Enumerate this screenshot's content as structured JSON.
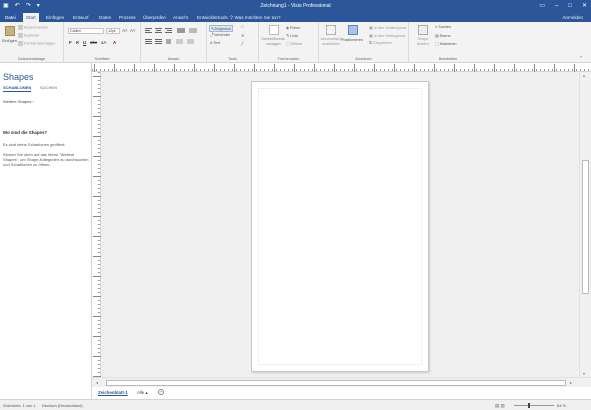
{
  "titlebar": {
    "title": "Zeichnung1 - Visio Professional",
    "qat": [
      "save-icon",
      "undo-icon",
      "redo-icon",
      "customize-icon"
    ],
    "window_buttons": [
      "▭",
      "–",
      "□",
      "✕"
    ]
  },
  "tabs": {
    "items": [
      "Datei",
      "Start",
      "Einfügen",
      "Entwurf",
      "Daten",
      "Prozess",
      "Überprüfen",
      "Ansicht",
      "Entwicklertools"
    ],
    "tellme": "Was möchten Sie tun?",
    "share": "Anmelden"
  },
  "ribbon": {
    "clipboard": {
      "paste": "Einfügen",
      "cut": "Ausschneiden",
      "copy": "Kopieren",
      "format_painter": "Format übertragen",
      "label": "Zwischenablage"
    },
    "font": {
      "font_name": "Calibri",
      "font_size": "12pt.",
      "bold": "F",
      "italic": "K",
      "underline": "U",
      "strike": "abc",
      "case": "aA",
      "color": "A",
      "label": "Schriftart"
    },
    "paragraph": {
      "label": "Absatz"
    },
    "tools": {
      "pointer": "Zeigertool",
      "connector": "Verbinder",
      "text": "Text",
      "label": "Tools"
    },
    "shape_styles": {
      "quick_styles": "Schnellformat-vorlagen",
      "fill": "Füllen",
      "line": "Linie",
      "effects": "Effekte",
      "label": "Formenarten"
    },
    "arrange": {
      "auto_align": "Automatisch ausrichten",
      "position": "Positionieren",
      "to_front": "In den Vordergrund",
      "to_back": "In den Hintergrund",
      "group": "Gruppieren",
      "label": "Anordnen"
    },
    "editing": {
      "change_shape": "Shape ändern",
      "find": "Suchen",
      "layers": "Ebene",
      "select": "Markieren",
      "label": "Bearbeiten"
    }
  },
  "pane": {
    "title": "Shapes",
    "tab_stencils": "SCHABLONEN",
    "tab_search": "SUCHEN",
    "more_shapes": "Weitere Shapes",
    "question": "Wo sind die Shapes?",
    "info1": "Es sind keine Schablonen geöffnet.",
    "info2": "Klicken Sie oben auf das Menü \"Weitere Shapes\", um Shape-Kategorien zu durchsuchen und Schablonen zu öffnen."
  },
  "pagetabs": {
    "page1": "Zeichenblatt-1",
    "all": "Alle ▴",
    "add": "+"
  },
  "status": {
    "page": "Zeichenbl. 1 von 1",
    "language": "Deutsch (Deutschland)",
    "zoom": "64 %"
  }
}
